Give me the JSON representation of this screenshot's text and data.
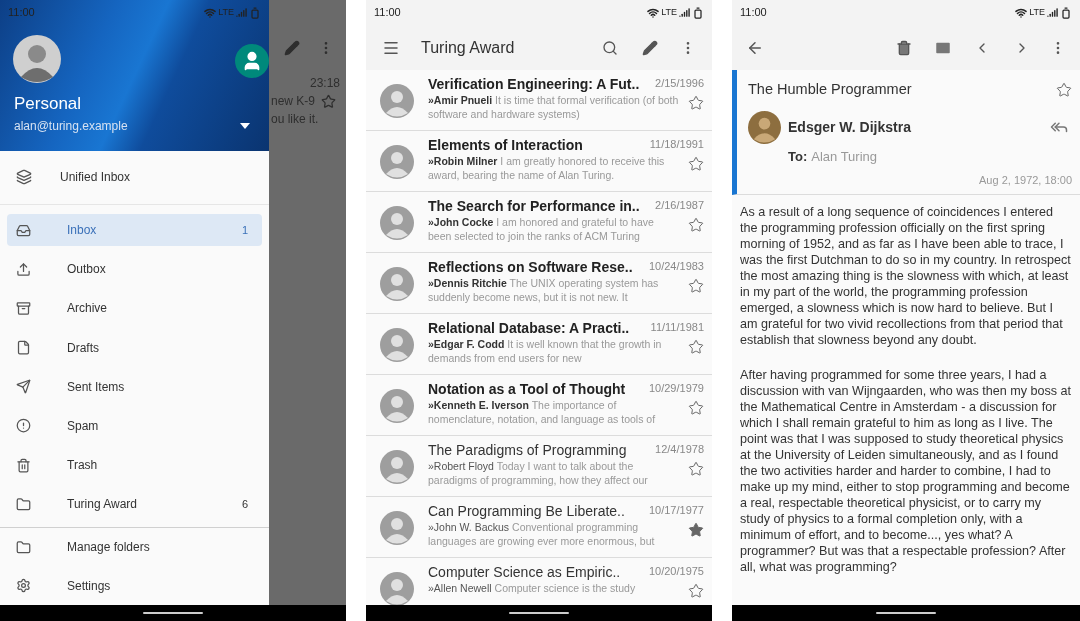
{
  "drawer_screen": {
    "status_bar": {
      "time": "11:00",
      "network": "LTE"
    },
    "account": {
      "name": "Personal",
      "email": "alan@turing.example"
    },
    "unified_inbox": {
      "label": "Unified Inbox"
    },
    "folders": [
      {
        "label": "Inbox",
        "count": "1",
        "selected": true
      },
      {
        "label": "Outbox",
        "selected": false
      },
      {
        "label": "Archive",
        "selected": false
      },
      {
        "label": "Drafts",
        "selected": false
      },
      {
        "label": "Sent Items",
        "selected": false
      },
      {
        "label": "Spam",
        "selected": false
      },
      {
        "label": "Trash",
        "selected": false
      },
      {
        "label": "Turing Award",
        "count": "6",
        "selected": false
      }
    ],
    "footer": [
      {
        "label": "Manage folders"
      },
      {
        "label": "Settings"
      }
    ],
    "behind": {
      "time": "23:18",
      "line_1": "new K-9",
      "line_2": "ou like it."
    }
  },
  "list_screen": {
    "status_bar": {
      "time": "11:00",
      "network": "LTE"
    },
    "title": "Turing Award",
    "messages": [
      {
        "subject": "Verification Engineering: A Fut..",
        "date": "2/15/1996",
        "sender": "»Amir Pnueli",
        "preview": "It is time that formal verification (of both software and hardware systems)",
        "unread": true,
        "starred": false
      },
      {
        "subject": "Elements of Interaction",
        "date": "11/18/1991",
        "sender": "»Robin Milner",
        "preview": "I am greatly honored to receive this award, bearing the name of Alan Turing.",
        "unread": true,
        "starred": false
      },
      {
        "subject": "The Search for Performance in..",
        "date": "2/16/1987",
        "sender": "»John Cocke",
        "preview": "I am honored and grateful to have been selected to join the ranks of ACM Turing",
        "unread": true,
        "starred": false
      },
      {
        "subject": "Reflections on Software Rese..",
        "date": "10/24/1983",
        "sender": "»Dennis Ritchie",
        "preview": "The UNIX operating system has suddenly become news, but it is not new. It",
        "unread": true,
        "starred": false
      },
      {
        "subject": "Relational Database: A Practi..",
        "date": "11/11/1981",
        "sender": "»Edgar F. Codd",
        "preview": "It is well known that the growth in demands from end users for new",
        "unread": true,
        "starred": false
      },
      {
        "subject": "Notation as a Tool of Thought",
        "date": "10/29/1979",
        "sender": "»Kenneth E. Iverson",
        "preview": "The importance of nomenclature, notation, and language as tools of",
        "unread": true,
        "starred": false
      },
      {
        "subject": "The Paradigms of Programming",
        "date": "12/4/1978",
        "sender": "»Robert Floyd",
        "preview": "Today I want to talk about the paradigms of programming, how they affect our",
        "unread": false,
        "starred": false
      },
      {
        "subject": "Can Programming Be Liberate..",
        "date": "10/17/1977",
        "sender": "»John W. Backus",
        "preview": "Conventional programming languages are growing ever more enormous, but",
        "unread": false,
        "starred": true
      },
      {
        "subject": "Computer Science as Empiric..",
        "date": "10/20/1975",
        "sender": "»Allen Newell",
        "preview": "Computer science is the study",
        "unread": false,
        "starred": false
      }
    ]
  },
  "message_screen": {
    "status_bar": {
      "time": "11:00",
      "network": "LTE"
    },
    "subject": "The Humble Programmer",
    "starred": false,
    "sender": "Edsger W. Dijkstra",
    "to_label": "To:",
    "to": "Alan Turing",
    "date": "Aug 2, 1972, 18:00",
    "paragraphs": [
      "As a result of a long sequence of coincidences I entered the programming profession officially on the first spring morning of 1952, and as far as I have been able to trace, I was the first Dutchman to do so in my country. In retrospect the most amazing thing is the slowness with which, at least in my part of the world, the programming profession emerged, a slowness which is now hard to believe. But I am grateful for two vivid recollections from that period that establish that slowness beyond any doubt.",
      "After having programmed for some three years, I had a discussion with van Wijngaarden, who was then my boss at the Mathematical Centre in Amsterdam - a discussion for which I shall remain grateful to him as long as I live. The point was that I was supposed to study theoretical physics at the University of Leiden simultaneously, and as I found the two activities harder and harder to combine, I had to make up my mind, either to stop programming and become a real, respectable theoretical physicist, or to carry my study of physics to a formal completion only, with a minimum of effort, and to become..., yes what? A programmer? But was that a respectable profession? After all, what was programming?"
    ]
  }
}
